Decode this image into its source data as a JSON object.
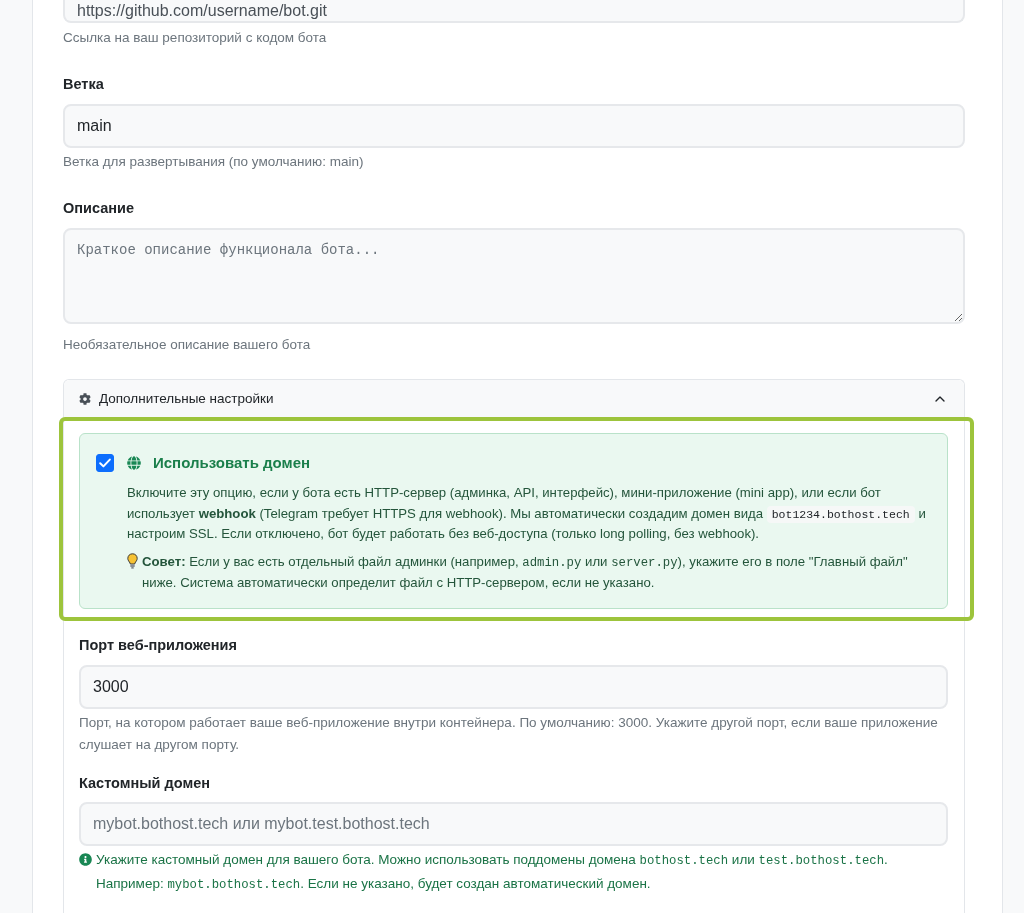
{
  "repository": {
    "value": "https://github.com/username/bot.git",
    "hint": "Ссылка на ваш репозиторий с кодом бота"
  },
  "branch": {
    "label": "Ветка",
    "value": "main",
    "hint": "Ветка для развертывания (по умолчанию: main)"
  },
  "description": {
    "label": "Описание",
    "placeholder": "Краткое описание функционала бота...",
    "hint": "Необязательное описание вашего бота"
  },
  "advanced_settings": {
    "title": "Дополнительные настройки",
    "expanded": true,
    "use_domain": {
      "checked": true,
      "highlighted": true,
      "label": "Использовать домен",
      "text": [
        {
          "kind": "text",
          "text": "Включите эту опцию, если у бота есть HTTP-сервер (админка, API, интерфейс), мини-приложение (mini app), или если бот использует "
        },
        {
          "kind": "bold",
          "text": "webhook"
        },
        {
          "kind": "text",
          "text": " (Telegram требует HTTPS для webhook). Мы автоматически создадим домен вида "
        },
        {
          "kind": "code",
          "text": "bot1234.bothost.tech"
        },
        {
          "kind": "text",
          "text": " и настроим SSL. Если отключено, бот будет работать без веб-доступа (только long polling, без webhook)."
        }
      ],
      "tip": [
        {
          "kind": "bold",
          "text": "Совет:"
        },
        {
          "kind": "text",
          "text": " Если у вас есть отдельный файл админки (например, "
        },
        {
          "kind": "mono",
          "text": "admin.py"
        },
        {
          "kind": "text",
          "text": " или "
        },
        {
          "kind": "mono",
          "text": "server.py"
        },
        {
          "kind": "text",
          "text": "), укажите его в поле \"Главный файл\" ниже. Система автоматически определит файл с HTTP-сервером, если не указано."
        }
      ]
    },
    "port": {
      "label": "Порт веб-приложения",
      "value": "3000",
      "hint": "Порт, на котором работает ваше веб-приложение внутри контейнера. По умолчанию: 3000. Укажите другой порт, если ваше приложение слушает на другом порту."
    },
    "custom_domain": {
      "label": "Кастомный домен",
      "placeholder": "mybot.bothost.tech или mybot.test.bothost.tech",
      "hint": [
        {
          "kind": "text",
          "text": "Укажите кастомный домен для вашего бота. Можно использовать поддомены домена "
        },
        {
          "kind": "mono",
          "text": "bothost.tech"
        },
        {
          "kind": "text",
          "text": " или "
        },
        {
          "kind": "mono",
          "text": "test.bothost.tech"
        },
        {
          "kind": "text",
          "text": ". Например: "
        },
        {
          "kind": "mono",
          "text": "mybot.bothost.tech"
        },
        {
          "kind": "text",
          "text": ". Если не указано, будет создан автоматический домен."
        }
      ]
    }
  }
}
